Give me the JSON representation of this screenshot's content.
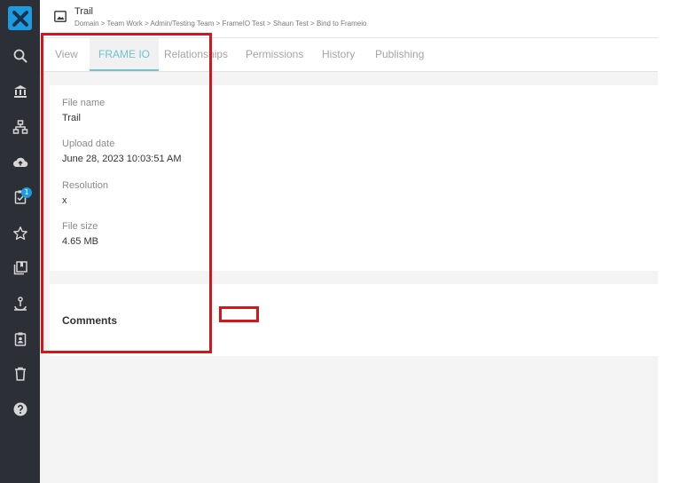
{
  "app": {
    "brand_color": "#1e9be0",
    "rail_color": "#2c2f36"
  },
  "sidebar": {
    "items": [
      {
        "icon": "search-icon"
      },
      {
        "icon": "institution-icon"
      },
      {
        "icon": "sitemap-icon"
      },
      {
        "icon": "cloud-upload-icon"
      },
      {
        "icon": "task-checklist-icon",
        "badge": "1"
      },
      {
        "icon": "star-icon"
      },
      {
        "icon": "collections-icon"
      },
      {
        "icon": "workflow-icon"
      },
      {
        "icon": "clipboard-user-icon"
      },
      {
        "icon": "trash-icon"
      },
      {
        "icon": "help-icon"
      }
    ]
  },
  "header": {
    "title": "Trail",
    "breadcrumb": "Domain > Team Work > Admin/Testing Team > FrameIO Test > Shaun Test > Bind to Frameio"
  },
  "tabs": [
    {
      "label": "View",
      "active": false
    },
    {
      "label": "FRAME IO",
      "active": true
    },
    {
      "label": "Relationships",
      "active": false
    },
    {
      "label": "Permissions",
      "active": false
    },
    {
      "label": "History",
      "active": false
    },
    {
      "label": "Publishing",
      "active": false
    }
  ],
  "details": {
    "file_name_label": "File name",
    "file_name_value": "Trail",
    "upload_date_label": "Upload date",
    "upload_date_value": "June 28, 2023 10:03:51 AM",
    "resolution_label": "Resolution",
    "resolution_value": "x",
    "file_size_label": "File size",
    "file_size_value": "4.65 MB"
  },
  "comments": {
    "title": "Comments"
  },
  "annotation_color": "#d2161e"
}
